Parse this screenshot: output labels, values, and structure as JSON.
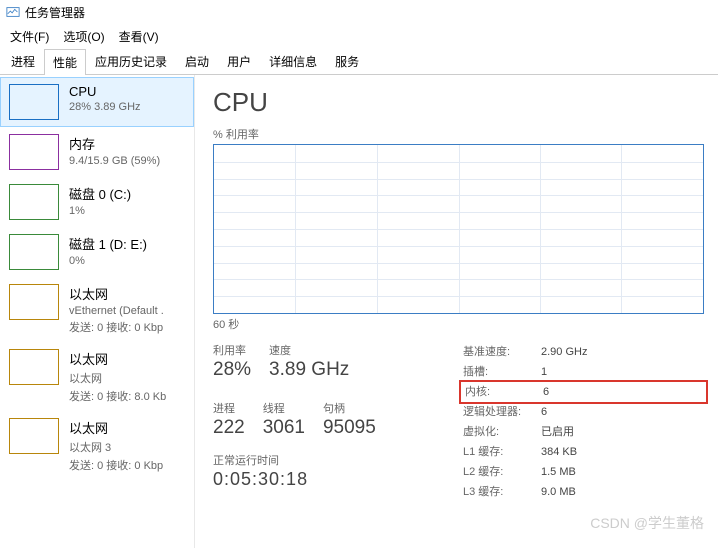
{
  "window": {
    "title": "任务管理器"
  },
  "menu": {
    "file": "文件(F)",
    "options": "选项(O)",
    "view": "查看(V)"
  },
  "tabs": {
    "processes": "进程",
    "performance": "性能",
    "apphistory": "应用历史记录",
    "startup": "启动",
    "users": "用户",
    "details": "详细信息",
    "services": "服务"
  },
  "sidebar": {
    "items": [
      {
        "title": "CPU",
        "sub": "28% 3.89 GHz"
      },
      {
        "title": "内存",
        "sub": "9.4/15.9 GB (59%)"
      },
      {
        "title": "磁盘 0 (C:)",
        "sub": "1%"
      },
      {
        "title": "磁盘 1 (D: E:)",
        "sub": "0%"
      },
      {
        "title": "以太网",
        "sub": "vEthernet (Default .",
        "sub2": "发送: 0 接收: 0 Kbp"
      },
      {
        "title": "以太网",
        "sub": "以太网",
        "sub2": "发送: 0 接收: 8.0 Kb"
      },
      {
        "title": "以太网",
        "sub": "以太网 3",
        "sub2": "发送: 0 接收: 0 Kbp"
      }
    ]
  },
  "detail": {
    "heading": "CPU",
    "chart_label": "% 利用率",
    "axis_bottom": "60 秒",
    "stats_left": [
      {
        "label": "利用率",
        "value": "28%"
      },
      {
        "label": "速度",
        "value": "3.89 GHz"
      },
      {
        "label": "进程",
        "value": "222"
      },
      {
        "label": "线程",
        "value": "3061"
      },
      {
        "label": "句柄",
        "value": "95095"
      }
    ],
    "uptime_label": "正常运行时间",
    "uptime_value": "0:05:30:18",
    "specs": [
      {
        "k": "基准速度:",
        "v": "2.90 GHz"
      },
      {
        "k": "插槽:",
        "v": "1"
      },
      {
        "k": "内核:",
        "v": "6"
      },
      {
        "k": "逻辑处理器:",
        "v": "6"
      },
      {
        "k": "虚拟化:",
        "v": "已启用"
      },
      {
        "k": "L1 缓存:",
        "v": "384 KB"
      },
      {
        "k": "L2 缓存:",
        "v": "1.5 MB"
      },
      {
        "k": "L3 缓存:",
        "v": "9.0 MB"
      }
    ]
  },
  "chart_data": {
    "type": "line",
    "title": "% 利用率",
    "xlabel": "60 秒",
    "ylabel": "",
    "ylim": [
      0,
      100
    ],
    "x_seconds": 60,
    "values": []
  },
  "watermark": "CSDN @学生董格"
}
